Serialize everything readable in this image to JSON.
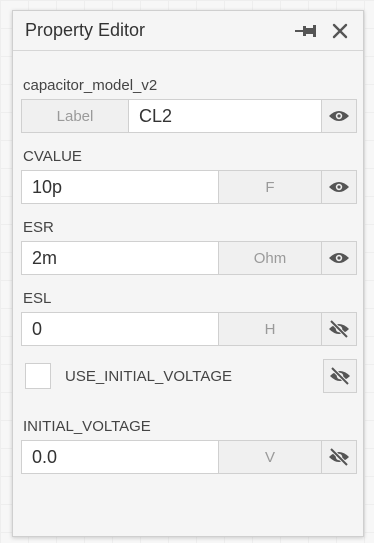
{
  "panel": {
    "title": "Property Editor",
    "pin_icon": "pin-icon",
    "close_icon": "close-icon"
  },
  "model": {
    "name": "capacitor_model_v2",
    "label_caption": "Label",
    "label_value": "CL2",
    "visible": true
  },
  "params": [
    {
      "name": "CVALUE",
      "value": "10p",
      "unit": "F",
      "visible": true
    },
    {
      "name": "ESR",
      "value": "2m",
      "unit": "Ohm",
      "visible": true
    },
    {
      "name": "ESL",
      "value": "0",
      "unit": "H",
      "visible": false
    }
  ],
  "use_initial_voltage": {
    "label": "USE_INITIAL_VOLTAGE",
    "checked": false,
    "visible": false
  },
  "initial_voltage": {
    "name": "INITIAL_VOLTAGE",
    "value": "0.0",
    "unit": "V",
    "visible": false
  },
  "colors": {
    "panel_bg": "#f5f5f5",
    "border": "#d0d0d0",
    "icon": "#555555",
    "unit_text": "#9a9a9a"
  }
}
